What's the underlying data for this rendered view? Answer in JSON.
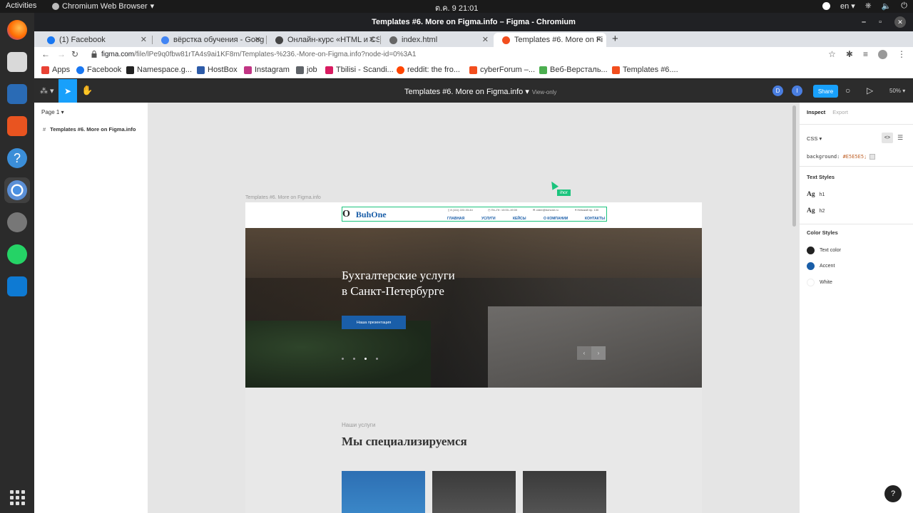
{
  "ubuntu": {
    "activities": "Activities",
    "app_name": "Chromium Web Browser",
    "clock": "ต.ค. 9  21:01",
    "lang": "en"
  },
  "window": {
    "title": "Templates #6. More on Figma.info – Figma - Chromium"
  },
  "tabs": [
    {
      "label": "(1) Facebook",
      "color": "#1877f2"
    },
    {
      "label": "вёрстка обучения - Goog",
      "color": "#4285f4"
    },
    {
      "label": "Онлайн-курс «HTML и CS",
      "color": "#444444"
    },
    {
      "label": "index.html",
      "color": "#666666"
    },
    {
      "label": "Templates #6. More on Fi",
      "color": "#f24e1e"
    }
  ],
  "address": {
    "host": "figma.com",
    "path": "/file/lPe9q0fbw81rTA4s9ai1KF8m/Templates-%236.-More-on-Figma.info?node-id=0%3A1"
  },
  "bookmarks": [
    {
      "label": "Apps",
      "color": "#e94235"
    },
    {
      "label": "Facebook",
      "color": "#1877f2"
    },
    {
      "label": "Namespace.g...",
      "color": "#222222"
    },
    {
      "label": "HostBox",
      "color": "#2d5ba8"
    },
    {
      "label": "Instagram",
      "color": "#c13584"
    },
    {
      "label": "job",
      "color": "#5f6368"
    },
    {
      "label": "Tbilisi - Scandi...",
      "color": "#d81b60"
    },
    {
      "label": "reddit: the fro...",
      "color": "#ff4500"
    },
    {
      "label": "cyberForum –...",
      "color": "#f24e1e"
    },
    {
      "label": "Веб-Версталь...",
      "color": "#4caf50"
    },
    {
      "label": "Templates #6....",
      "color": "#f24e1e"
    }
  ],
  "figma": {
    "file_title": "Templates #6. More on Figma.info",
    "view_only": "View-only",
    "avatar_d": "D",
    "avatar_i": "I",
    "share": "Share",
    "zoom": "50%",
    "page": "Page 1",
    "layer": "Templates #6. More on Figma.info",
    "accent": "#18a0fb"
  },
  "canvas": {
    "frame_label": "Templates #6. More on Figma.info",
    "cursor_name": "ihor",
    "site": {
      "brand": "BuhOne",
      "phone": "8 (111) 222-33-44",
      "hours": "Пн–Пт: 10:00–19:00",
      "email": "order@buhone.ru",
      "address": "Невский пр. 130",
      "menu": [
        "ГЛАВНАЯ",
        "УСЛУГИ",
        "КЕЙСЫ",
        "О КОМПАНИИ",
        "КОНТАКТЫ"
      ],
      "hero_title_1": "Бухгалтерские услуги",
      "hero_title_2": "в Санкт-Петербурге",
      "hero_button": "Наша презентация",
      "services_label": "Наши услуги",
      "services_title": "Мы специализируемся"
    }
  },
  "inspect": {
    "tab_inspect": "Inspect",
    "tab_export": "Export",
    "lang": "CSS",
    "bg_prop": "background:",
    "bg_val": "#E5E5E5;",
    "text_styles_title": "Text Styles",
    "text_styles": [
      {
        "ag": "Ag",
        "name": "h1"
      },
      {
        "ag": "Ag",
        "name": "h2"
      }
    ],
    "color_styles_title": "Color Styles",
    "color_styles": [
      {
        "name": "Text color",
        "color": "#222222"
      },
      {
        "name": "Accent",
        "color": "#1a5ea8"
      },
      {
        "name": "White",
        "color": "#ffffff"
      }
    ]
  }
}
